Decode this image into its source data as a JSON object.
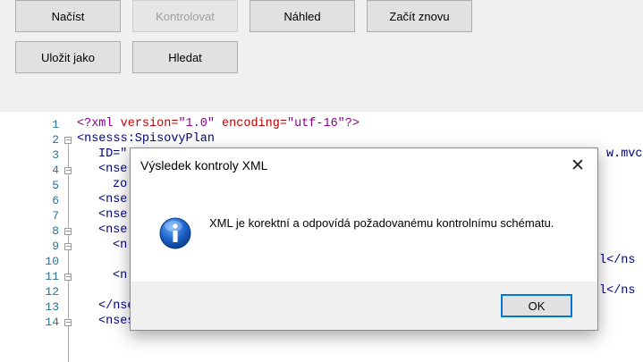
{
  "toolbar": {
    "load": "Načíst",
    "check": "Kontrolovat",
    "preview": "Náhled",
    "restart": "Začít znovu",
    "save_as": "Uložit jako",
    "search": "Hledat"
  },
  "editor": {
    "line_numbers": [
      "1",
      "2",
      "3",
      "4",
      "5",
      "6",
      "7",
      "8",
      "9",
      "10",
      "11",
      "12",
      "13",
      "14"
    ],
    "lines": {
      "l1": {
        "decl": "<?xml",
        "attr1": " version=",
        "val1": "\"1.0\"",
        "attr2": " encoding=",
        "val2": "\"utf-16\"",
        "end": "?>"
      },
      "l2": "<nsesss:SpisovyPlan",
      "l3": "ID=\"",
      "l3_right": "w.mvc",
      "l4": "<nse",
      "l5": "zo",
      "l6": "<nse",
      "l7": "<nse",
      "l8": "<nse",
      "l9": "<n",
      "l10_right": "l</ns",
      "l11": "<n",
      "l12_right": "l</ns",
      "l13": "</nsesss:Manipulace>",
      "l14": "<nsesss:Vydavatel>"
    }
  },
  "dialog": {
    "title": "Výsledek kontroly XML",
    "message": "XML je korektní a odpovídá požadovanému kontrolnímu schématu.",
    "ok": "OK",
    "icon": "info-icon",
    "close_icon": "close-icon"
  }
}
